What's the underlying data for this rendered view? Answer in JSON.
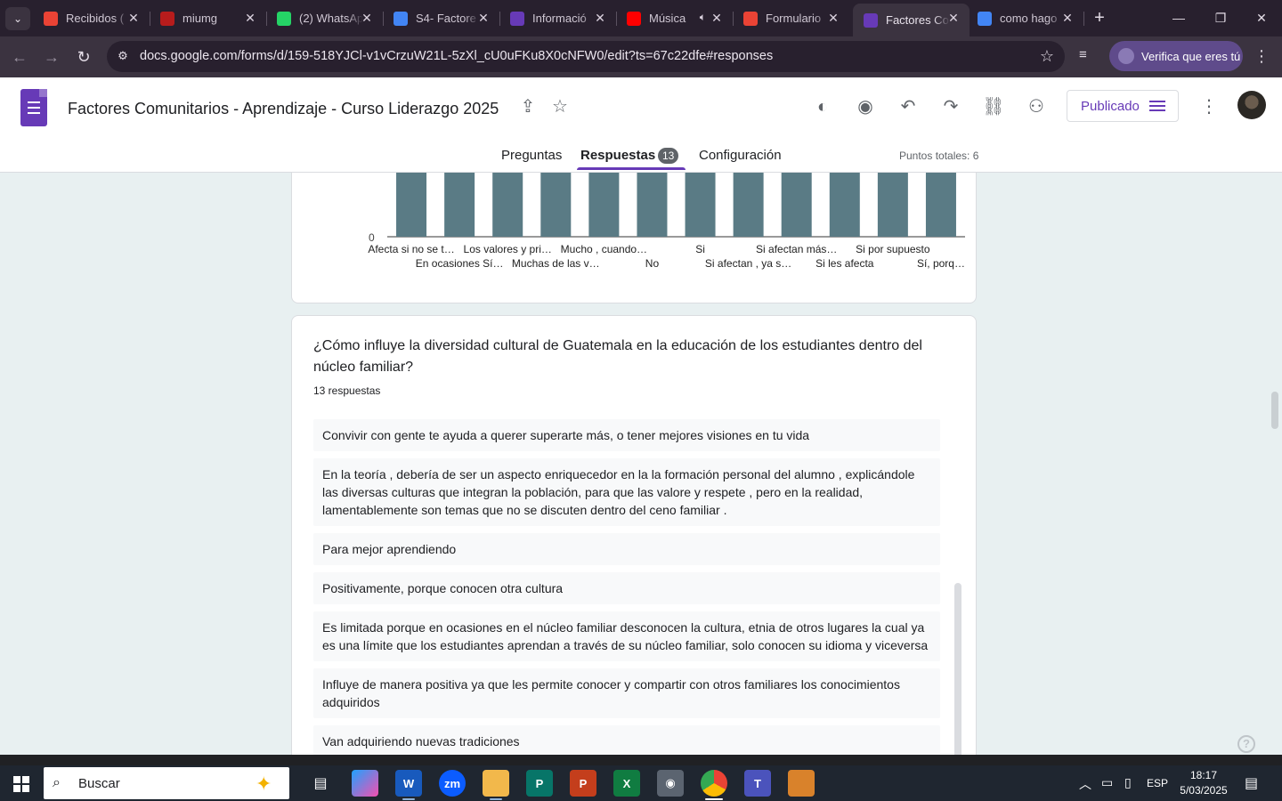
{
  "browser": {
    "tabs": [
      {
        "title": "Recibidos (",
        "icon": "gmail-icon",
        "color": "#ea4335"
      },
      {
        "title": "miumg",
        "icon": "umg-icon",
        "color": "#b71c1c"
      },
      {
        "title": "(2) WhatsAp",
        "icon": "whatsapp-icon",
        "color": "#25d366"
      },
      {
        "title": "S4- Factore",
        "icon": "docs-icon",
        "color": "#4285f4"
      },
      {
        "title": "Informació",
        "icon": "forms-icon",
        "color": "#673ab7"
      },
      {
        "title": "Música",
        "icon": "youtube-icon",
        "color": "#ff0000"
      },
      {
        "title": "Formulario",
        "icon": "gmail-icon",
        "color": "#ea4335"
      },
      {
        "title": "Factores Co",
        "icon": "forms-icon",
        "color": "#673ab7"
      },
      {
        "title": "como hago",
        "icon": "google-icon",
        "color": "#4285f4"
      }
    ],
    "url": "docs.google.com/forms/d/159-518YJCl-v1vCrzuW21L-5zXl_cU0uFKu8X0cNFW0/edit?ts=67c22dfe#responses",
    "verify_label": "Verifica que eres tú"
  },
  "form": {
    "title": "Factores  Comunitarios - Aprendizaje - Curso Liderazgo 2025",
    "publish_label": "Publicado",
    "tabs": {
      "questions": "Preguntas",
      "responses": "Respuestas",
      "settings": "Configuración"
    },
    "responses_count": "13",
    "total_points": "Puntos totales: 6"
  },
  "chart_data": {
    "type": "bar",
    "categories": [
      "Afecta si no se t…",
      "En ocasiones Sí…",
      "Los valores y pri…",
      "Muchas de las v…",
      "Mucho , cuando…",
      "No",
      "Si",
      "Si afectan , ya s…",
      "Si afectan más…",
      "Si les afecta",
      "Si por supuesto",
      "Sí, porq…"
    ],
    "values": [
      1,
      1,
      1,
      1,
      1,
      1,
      1,
      1,
      1,
      1,
      1,
      1
    ],
    "y_tick_visible": "0",
    "bar_color": "#5a7b85"
  },
  "question": {
    "title": "¿Cómo influye la diversidad cultural de Guatemala en la educación de los estudiantes dentro del núcleo familiar?",
    "count": "13 respuestas",
    "responses": [
      "Convivir con gente te ayuda a querer superarte más, o tener mejores visiones en tu vida",
      "En la teoría , debería de ser un aspecto enriquecedor en la la formación personal del alumno , explicándole las diversas culturas que integran la población, para que las valore y respete , pero en la realidad, lamentablemente son temas que no se discuten dentro del ceno familiar .",
      "Para mejor aprendiendo",
      "Positivamente, porque conocen otra cultura",
      "Es limitada porque en ocasiones en el núcleo familiar desconocen la cultura, etnia de otros lugares la cual ya es una límite que los estudiantes aprendan a través de su núcleo familiar, solo conocen su idioma y viceversa",
      "Influye de manera positiva ya que les permite conocer y compartir con otros familiares los conocimientos adquiridos",
      "Van adquiriendo nuevas tradiciones"
    ]
  },
  "taskbar": {
    "search_placeholder": "Buscar",
    "lang": "ESP",
    "time": "18:17",
    "date": "5/03/2025"
  }
}
